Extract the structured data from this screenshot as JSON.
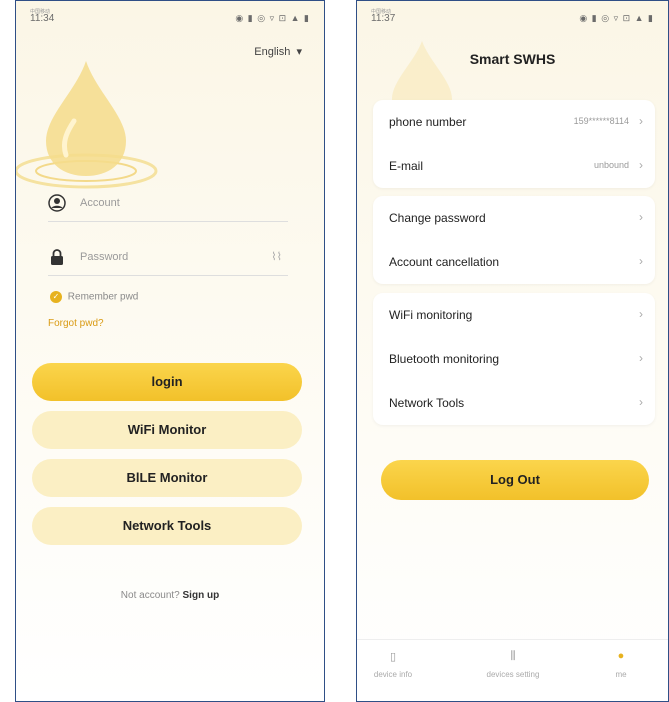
{
  "login": {
    "status": {
      "time": "11:34",
      "carrier": "中国移动",
      "icons": "◉ ▮ ◎ ▿ ⊡ ▲ ▮"
    },
    "language": "English",
    "account_placeholder": "Account",
    "password_placeholder": "Password",
    "remember_label": "Remember pwd",
    "forgot_label": "Forgot pwd?",
    "login_button": "login",
    "wifi_button": "WiFi Monitor",
    "ble_button": "BlLE Monitor",
    "network_button": "Network Tools",
    "no_account": "Not account?",
    "signup": "Sign up",
    "accent": "#f2c12a"
  },
  "profile": {
    "status": {
      "time": "11:37",
      "carrier": "中国移动",
      "icons": "◉ ▮ ◎ ▿ ⊡ ▲ ▮"
    },
    "title": "Smart SWHS",
    "account_rows": [
      {
        "label": "phone number",
        "value": "159******8114"
      },
      {
        "label": "E-mail",
        "value": "unbound"
      }
    ],
    "security_rows": [
      {
        "label": "Change password",
        "value": ""
      },
      {
        "label": "Account cancellation",
        "value": ""
      }
    ],
    "tools_rows": [
      {
        "label": "WiFi monitoring",
        "value": ""
      },
      {
        "label": "Bluetooth monitoring",
        "value": ""
      },
      {
        "label": "Network Tools",
        "value": ""
      }
    ],
    "chevron": "›",
    "logout_button": "Log Out",
    "tabs": [
      {
        "label": "device info",
        "icon": "device-icon"
      },
      {
        "label": "devices setting",
        "icon": "settings-icon"
      },
      {
        "label": "me",
        "icon": "user-icon"
      }
    ]
  }
}
